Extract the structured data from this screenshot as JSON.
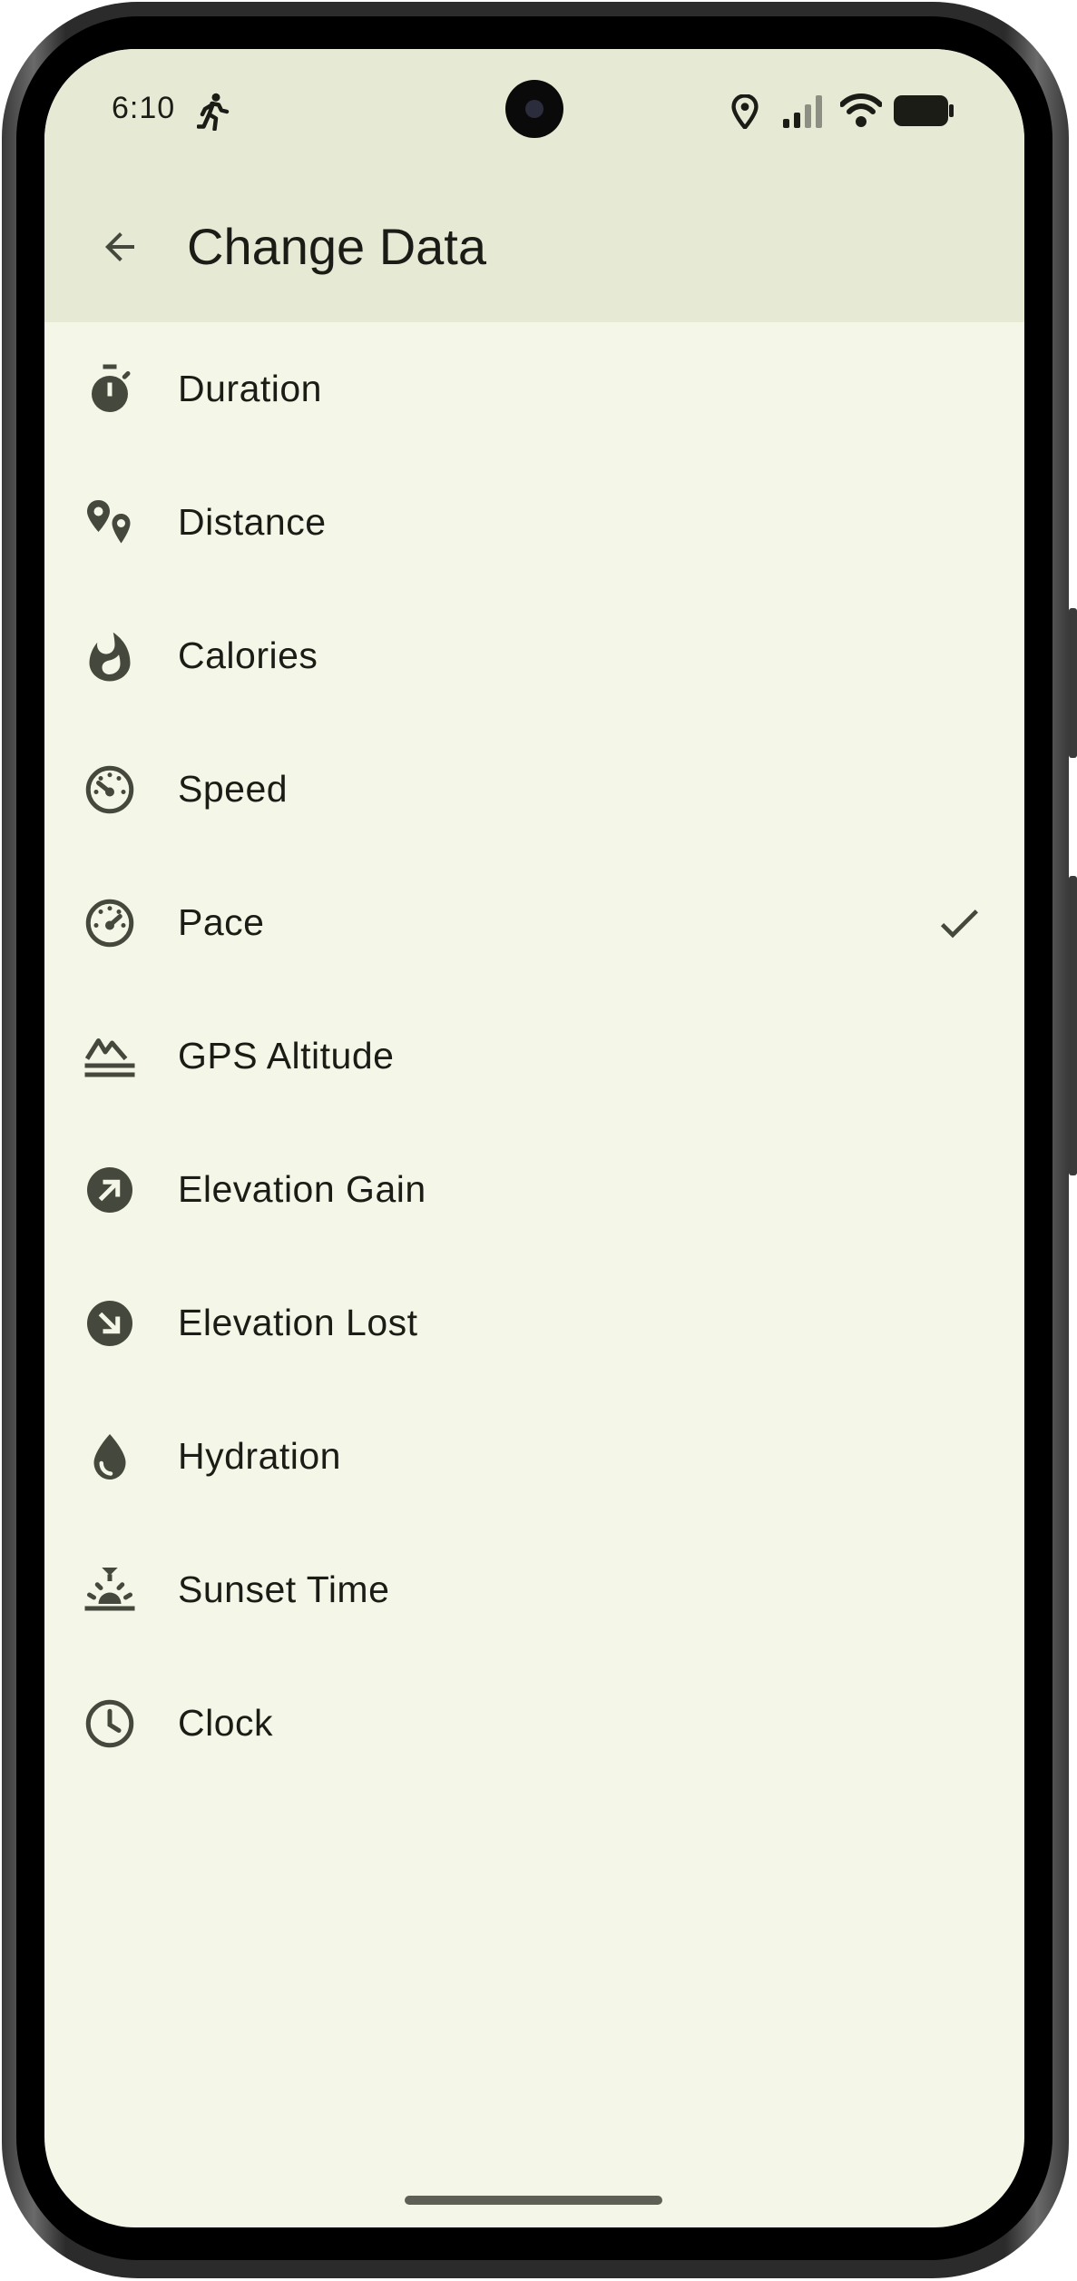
{
  "status_bar": {
    "time": "6:10",
    "icons": [
      "running-person-icon",
      "location-icon",
      "signal-icon",
      "wifi-icon",
      "battery-icon"
    ]
  },
  "app_bar": {
    "back_icon": "arrow-back-icon",
    "title": "Change Data"
  },
  "colors": {
    "background": "#f4f7e7",
    "app_bar_background": "#e6ead4",
    "text": "#1c1c17",
    "icon": "#45483c"
  },
  "list": {
    "items": [
      {
        "label": "Duration",
        "icon": "stopwatch-icon",
        "selected": false
      },
      {
        "label": "Distance",
        "icon": "distance-pins-icon",
        "selected": false
      },
      {
        "label": "Calories",
        "icon": "flame-icon",
        "selected": false
      },
      {
        "label": "Speed",
        "icon": "speedometer-icon",
        "selected": false
      },
      {
        "label": "Pace",
        "icon": "speedometer-icon",
        "selected": true
      },
      {
        "label": "GPS Altitude",
        "icon": "mountains-icon",
        "selected": false
      },
      {
        "label": "Elevation Gain",
        "icon": "arrow-up-right-circle-icon",
        "selected": false
      },
      {
        "label": "Elevation Lost",
        "icon": "arrow-down-right-circle-icon",
        "selected": false
      },
      {
        "label": "Hydration",
        "icon": "water-drop-icon",
        "selected": false
      },
      {
        "label": "Sunset Time",
        "icon": "sunset-icon",
        "selected": false
      },
      {
        "label": "Clock",
        "icon": "clock-icon",
        "selected": false
      }
    ],
    "selected_icon": "check-icon"
  }
}
